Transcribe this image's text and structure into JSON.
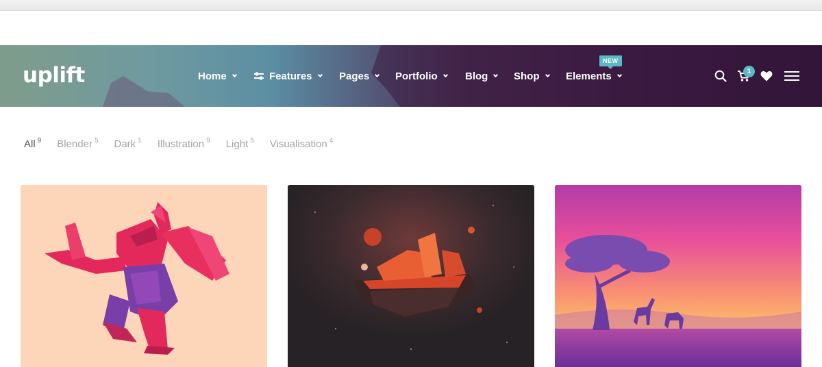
{
  "header": {
    "logo": "uplift",
    "nav": [
      {
        "label": "Home"
      },
      {
        "label": "Features"
      },
      {
        "label": "Pages"
      },
      {
        "label": "Portfolio"
      },
      {
        "label": "Blog"
      },
      {
        "label": "Shop"
      },
      {
        "label": "Elements",
        "badge": "NEW"
      }
    ],
    "cart_count": "1",
    "icons": [
      "search-icon",
      "cart-icon",
      "heart-icon",
      "menu-icon"
    ],
    "accent_color": "#5bb8c5"
  },
  "filters": [
    {
      "label": "All",
      "count": "9",
      "active": true
    },
    {
      "label": "Blender",
      "count": "5"
    },
    {
      "label": "Dark",
      "count": "1"
    },
    {
      "label": "Illustration",
      "count": "9"
    },
    {
      "label": "Light",
      "count": "5"
    },
    {
      "label": "Visualisation",
      "count": "4"
    }
  ],
  "portfolio": {
    "colors": [
      "#fdd5b9",
      "#2a2528",
      "#e84f9a"
    ]
  }
}
